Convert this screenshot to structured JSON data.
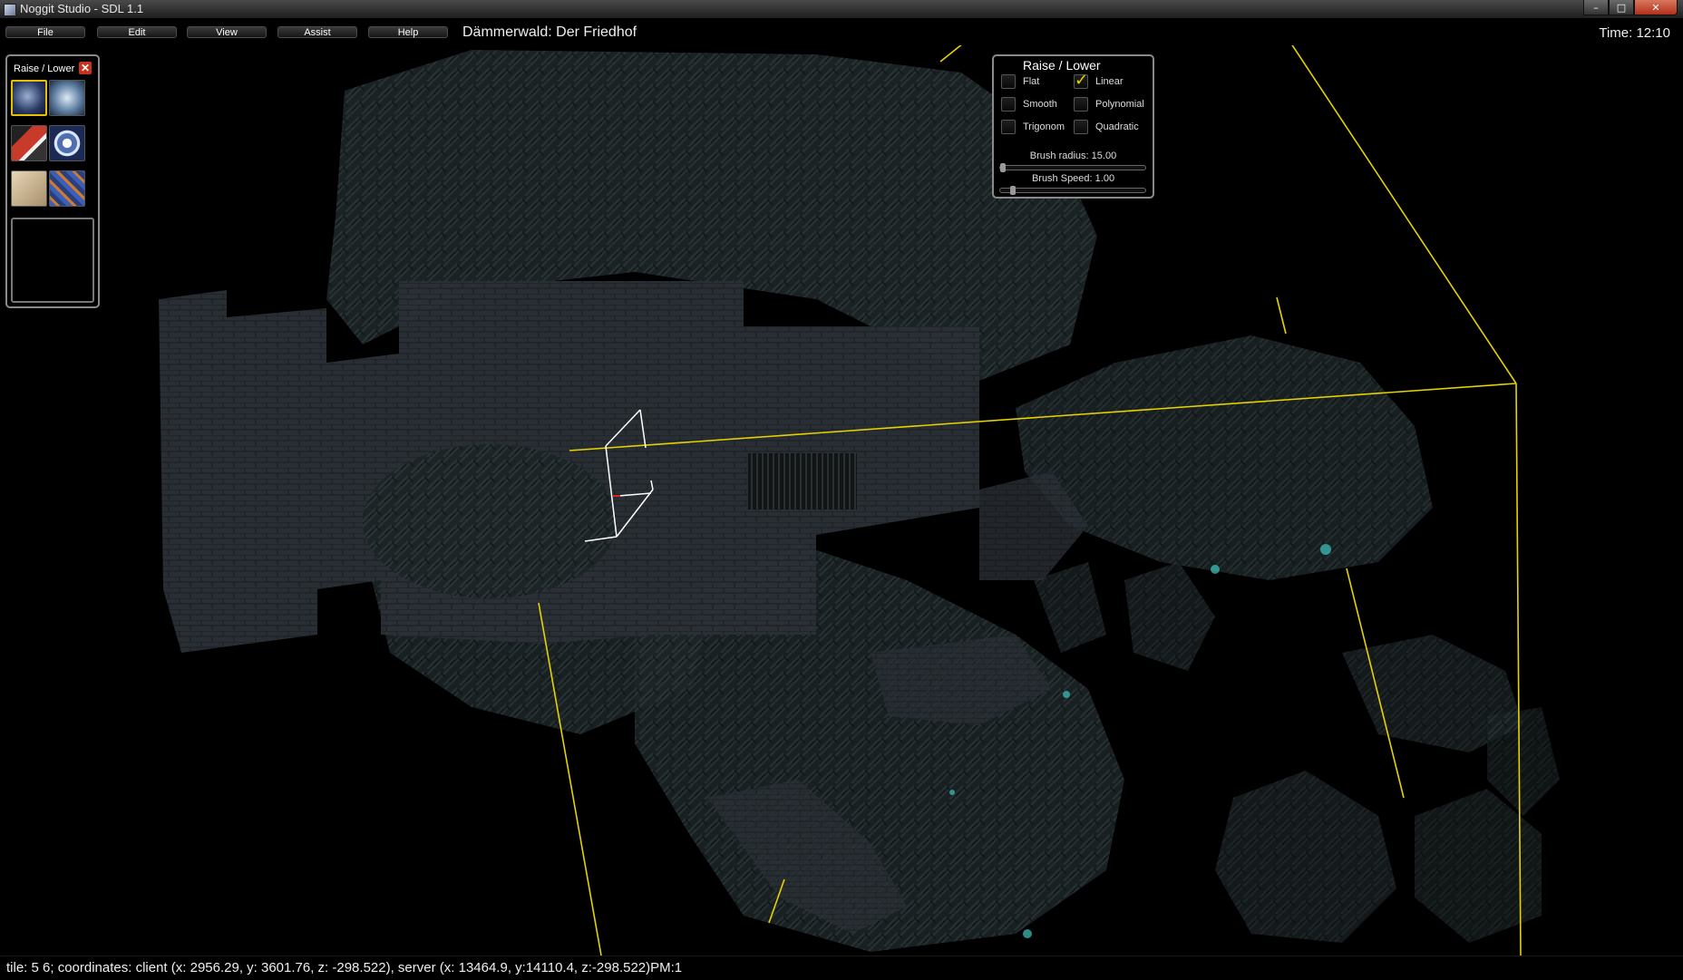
{
  "window": {
    "title": "Noggit Studio - SDL 1.1",
    "min_symbol": "–",
    "max_symbol": "□",
    "close_symbol": "✕"
  },
  "menu": {
    "items": [
      {
        "label": "File"
      },
      {
        "label": "Edit"
      },
      {
        "label": "View"
      },
      {
        "label": "Assist"
      },
      {
        "label": "Help"
      }
    ],
    "map_name": "Dämmerwald: Der Friedhof",
    "time": "Time: 12:10"
  },
  "toolbox": {
    "title": "Raise / Lower",
    "close_symbol": "✕",
    "tools": [
      {
        "name": "raise-lower-tool-icon",
        "selected": true
      },
      {
        "name": "flatten-blur-tool-icon",
        "selected": false
      },
      {
        "name": "texture-paint-tool-icon",
        "selected": false
      },
      {
        "name": "hole-tool-icon",
        "selected": false
      },
      {
        "name": "area-id-tool-icon",
        "selected": false
      },
      {
        "name": "impassable-tool-icon",
        "selected": false
      }
    ]
  },
  "settings": {
    "title": "Raise / Lower",
    "options": [
      {
        "label": "Flat",
        "checked": false
      },
      {
        "label": "Linear",
        "checked": true
      },
      {
        "label": "Smooth",
        "checked": false
      },
      {
        "label": "Polynomial",
        "checked": false
      },
      {
        "label": "Trigonom",
        "checked": false
      },
      {
        "label": "Quadratic",
        "checked": false
      }
    ],
    "brush_radius_label": "Brush radius: 15.00",
    "brush_speed_label": "Brush Speed: 1.00",
    "brush_radius_fraction": 0.0,
    "brush_speed_fraction": 0.07,
    "checkmark": "✓"
  },
  "status": {
    "text": "tile: 5 6; coordinates: client (x: 2956.29, y: 3601.76, z: -298.522), server (x: 13464.9, y:14110.4, z:-298.522)PM:1"
  },
  "colors": {
    "chunk_line": "#e6d200",
    "cursor": "#ffffff"
  }
}
